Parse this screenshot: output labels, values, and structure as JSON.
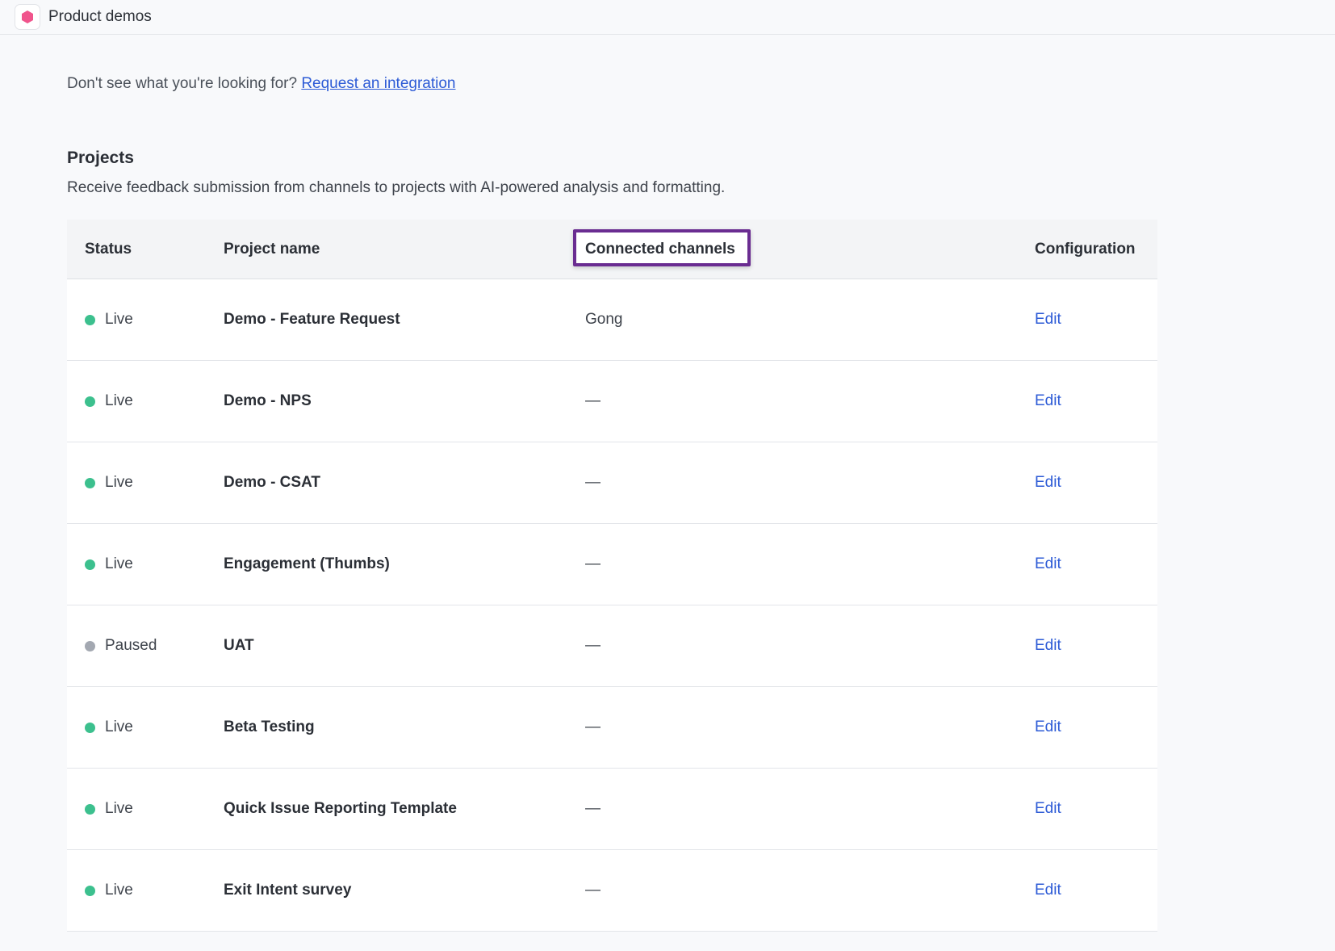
{
  "header": {
    "title": "Product demos",
    "logo_icon": "hexagon-logo-icon",
    "logo_color": "#f0548c"
  },
  "request": {
    "prompt": "Don't see what you're looking for?",
    "link_label": "Request an integration"
  },
  "projects": {
    "title": "Projects",
    "description": "Receive feedback submission from channels to projects with AI-powered analysis and formatting."
  },
  "table": {
    "headers": {
      "status": "Status",
      "name": "Project name",
      "channels": "Connected channels",
      "config": "Configuration"
    },
    "status_colors": {
      "Live": "#3cc08e",
      "Paused": "#a3a8b1"
    },
    "rows": [
      {
        "status": "Live",
        "name": "Demo - Feature Request",
        "channels": "Gong",
        "action": "Edit"
      },
      {
        "status": "Live",
        "name": "Demo - NPS",
        "channels": "—",
        "action": "Edit"
      },
      {
        "status": "Live",
        "name": "Demo - CSAT",
        "channels": "—",
        "action": "Edit"
      },
      {
        "status": "Live",
        "name": "Engagement (Thumbs)",
        "channels": "—",
        "action": "Edit"
      },
      {
        "status": "Paused",
        "name": "UAT",
        "channels": "—",
        "action": "Edit"
      },
      {
        "status": "Live",
        "name": "Beta Testing",
        "channels": "—",
        "action": "Edit"
      },
      {
        "status": "Live",
        "name": "Quick Issue Reporting Template",
        "channels": "—",
        "action": "Edit"
      },
      {
        "status": "Live",
        "name": "Exit Intent survey",
        "channels": "—",
        "action": "Edit"
      }
    ]
  }
}
